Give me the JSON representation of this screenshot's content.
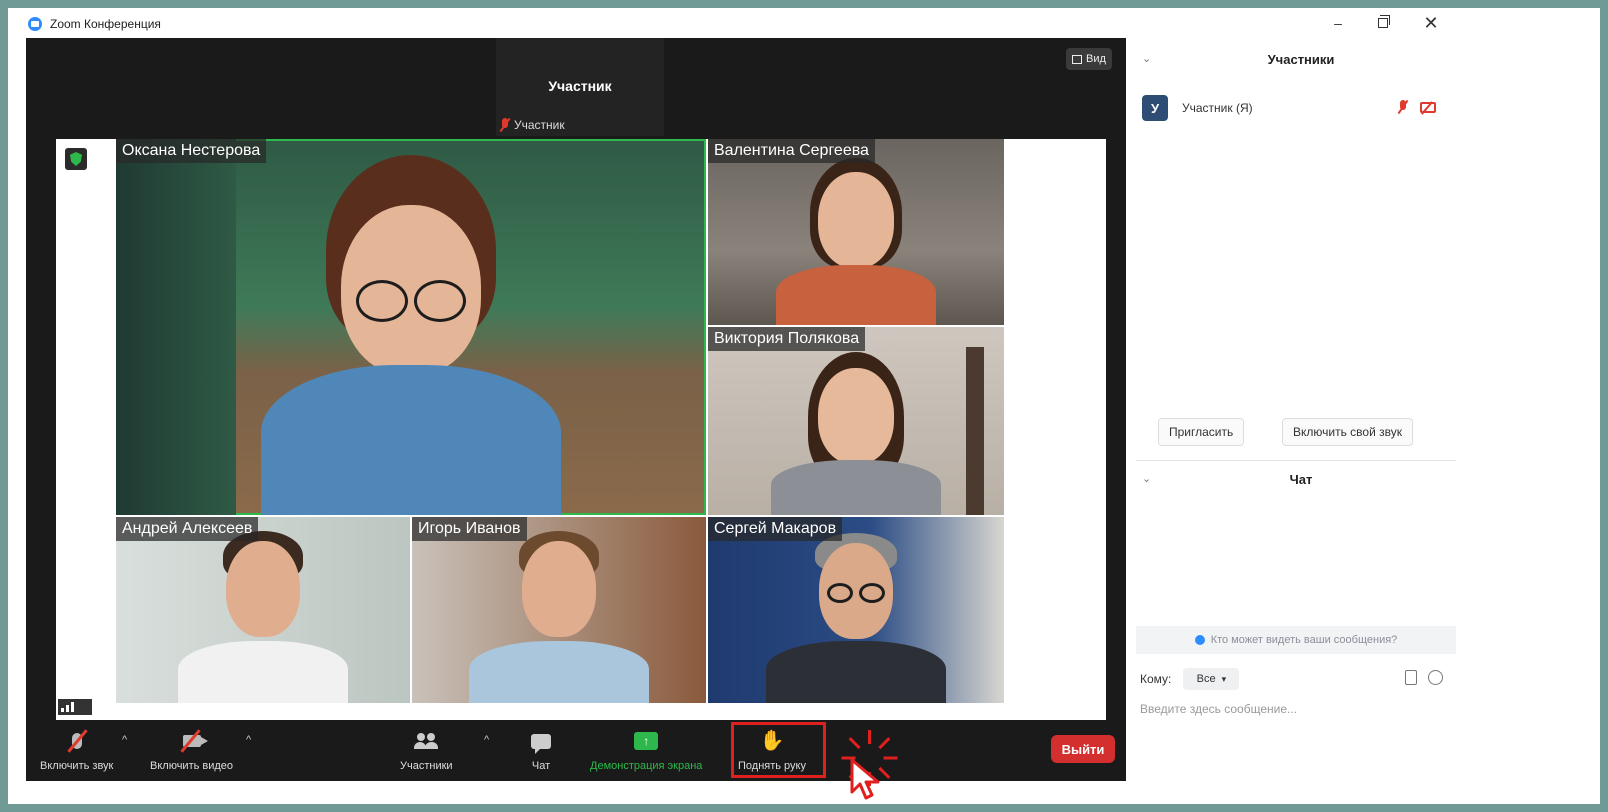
{
  "window": {
    "title": "Zoom Конференция",
    "minimize": "–",
    "close": "✕"
  },
  "meeting": {
    "active_speaker": {
      "name": "Участник",
      "label": "Участник"
    },
    "view_button": "Вид",
    "tiles": [
      {
        "name": "Оксана Нестерова"
      },
      {
        "name": "Валентина Сергеева"
      },
      {
        "name": "Виктория Полякова"
      },
      {
        "name": "Андрей Алексеев"
      },
      {
        "name": "Игорь Иванов"
      },
      {
        "name": "Сергей Макаров"
      }
    ]
  },
  "toolbar": {
    "audio": "Включить звук",
    "video": "Включить видео",
    "participants": "Участники",
    "chat": "Чат",
    "share": "Демонстрация экрана",
    "raise_hand": "Поднять руку",
    "leave": "Выйти",
    "caret": "^"
  },
  "panel": {
    "participants_title": "Участники",
    "chevron": "⌄",
    "participant": {
      "avatar": "У",
      "name": "Участник (Я)"
    },
    "invite": "Пригласить",
    "unmute_self": "Включить свой звук",
    "chat_title": "Чат",
    "who_sees": "Кто может видеть ваши сообщения?",
    "to_label": "Кому:",
    "to_value": "Все",
    "message_placeholder": "Введите здесь сообщение..."
  },
  "colors": {
    "accent_green": "#2eb84b",
    "leave_red": "#d32f2f",
    "highlight_red": "#e01f1f",
    "zoom_blue": "#2d8cff"
  }
}
